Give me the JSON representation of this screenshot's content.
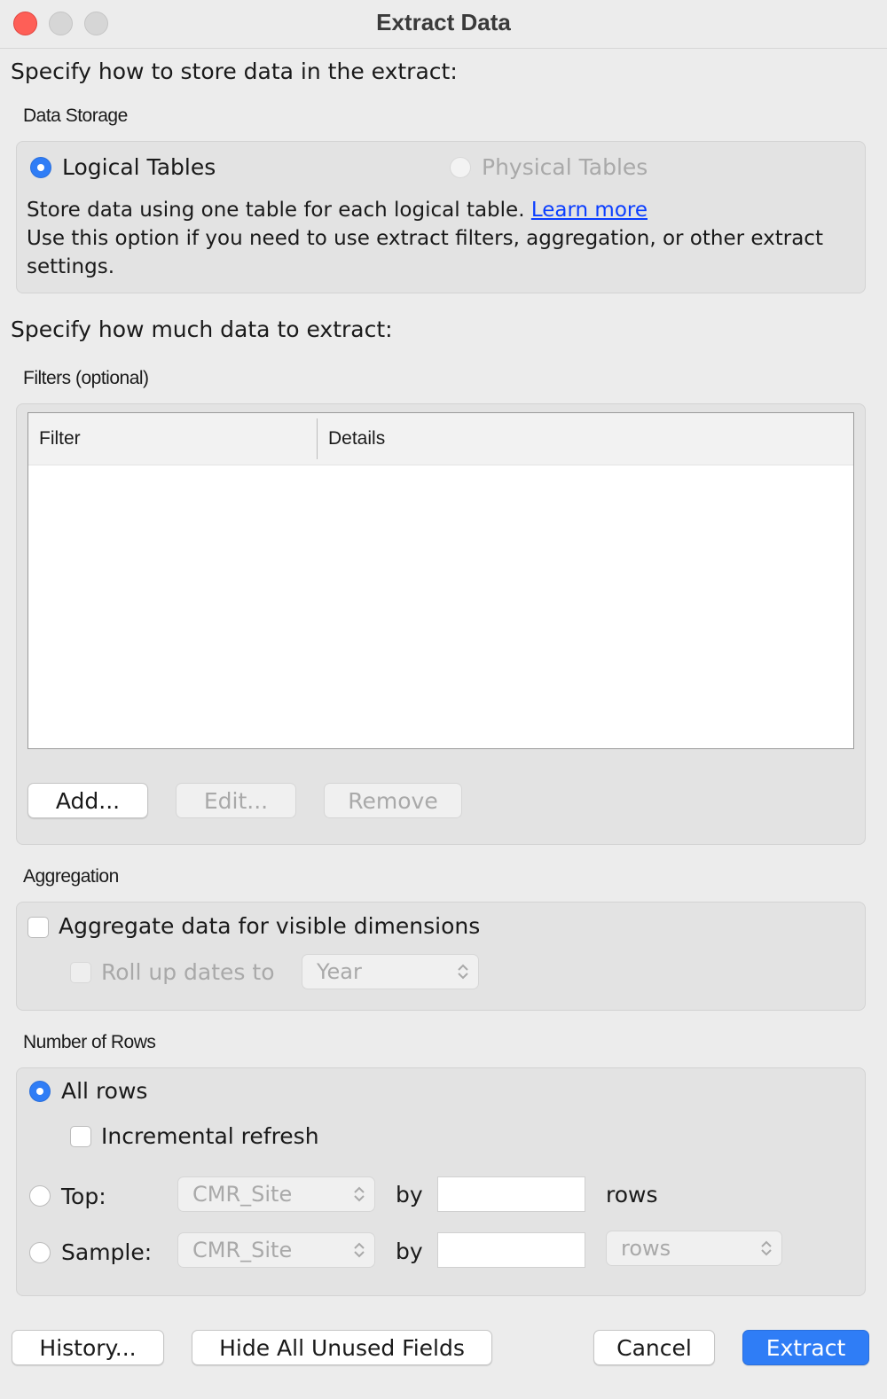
{
  "window": {
    "title": "Extract Data"
  },
  "storage_section": {
    "heading": "Specify how to store data in the extract:",
    "group_label": "Data Storage",
    "option_logical": "Logical Tables",
    "option_physical": "Physical Tables",
    "description_1": "Store data using one table for each logical table.",
    "learn_more": "Learn more",
    "description_2": "Use this option if you need to use extract filters, aggregation, or other extract settings."
  },
  "extract_section": {
    "heading": "Specify how much data to extract:"
  },
  "filters": {
    "group_label": "Filters (optional)",
    "columns": [
      "Filter",
      "Details"
    ],
    "rows": [],
    "add_label": "Add...",
    "edit_label": "Edit...",
    "remove_label": "Remove"
  },
  "aggregation": {
    "group_label": "Aggregation",
    "aggregate_label": "Aggregate data for visible dimensions",
    "aggregate_checked": false,
    "rollup_label": "Roll up dates to",
    "rollup_value": "Year"
  },
  "number_of_rows": {
    "group_label": "Number of Rows",
    "all_rows_label": "All rows",
    "incremental_label": "Incremental refresh",
    "top_label": "Top:",
    "top_field": "CMR_Site",
    "by_label": "by",
    "top_count": "",
    "top_unit": "rows",
    "sample_label": "Sample:",
    "sample_field": "CMR_Site",
    "sample_count": "",
    "sample_unit": "rows",
    "selected": "All rows"
  },
  "footer": {
    "history_label": "History...",
    "hide_unused_label": "Hide All Unused Fields",
    "cancel_label": "Cancel",
    "extract_label": "Extract"
  },
  "colors": {
    "accent": "#2f7df6",
    "link": "#0a3dff",
    "close": "#fe5f57"
  }
}
